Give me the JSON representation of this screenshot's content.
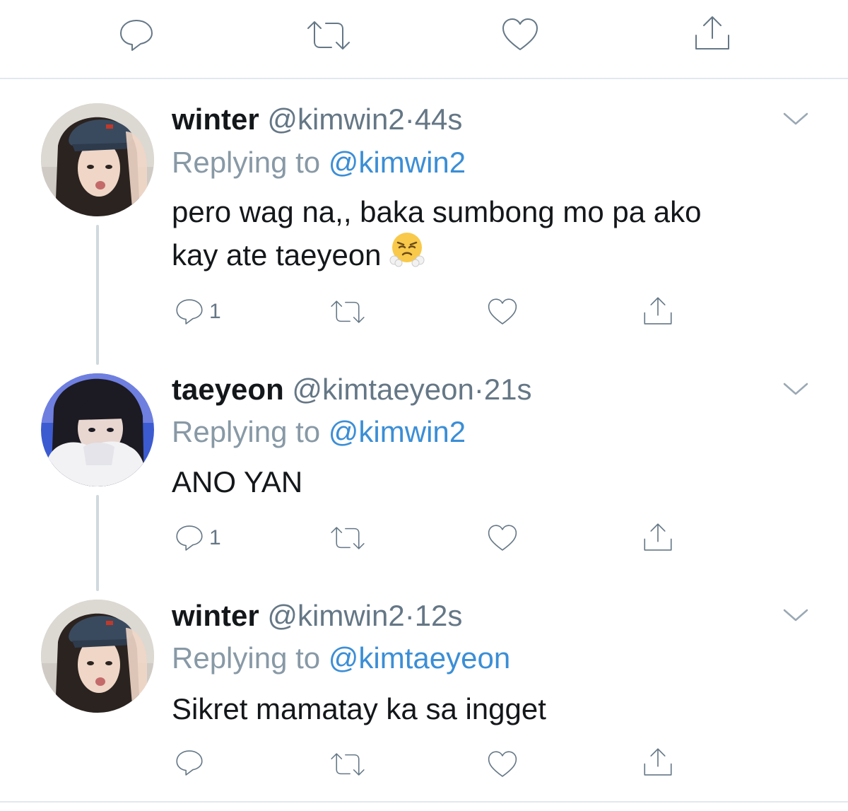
{
  "colors": {
    "link": "#3b8ed6",
    "icon": "#657786",
    "divider": "#e1e8ed"
  },
  "top_actions": {
    "icons": [
      "reply-icon",
      "retweet-icon",
      "like-icon",
      "share-icon"
    ]
  },
  "tweets": [
    {
      "name": "winter",
      "handle": "@kimwin2",
      "separator": "·",
      "time": "44s",
      "replying_label": "Replying to",
      "replying_to": "@kimwin2",
      "text_line1": "pero wag na,, baka sumbong mo pa ako",
      "text_line2": "kay ate taeyeon",
      "emoji": "face-with-steam-from-nose",
      "reply_count": "1"
    },
    {
      "name": "taeyeon",
      "handle": "@kimtaeyeon",
      "separator": "·",
      "time": "21s",
      "replying_label": "Replying to",
      "replying_to": "@kimwin2",
      "text_line1": "ANO YAN",
      "reply_count": "1"
    },
    {
      "name": "winter",
      "handle": "@kimwin2",
      "separator": "·",
      "time": "12s",
      "replying_label": "Replying to",
      "replying_to": "@kimtaeyeon",
      "text_line1": "Sikret mamatay ka sa ingget",
      "reply_count": ""
    }
  ]
}
